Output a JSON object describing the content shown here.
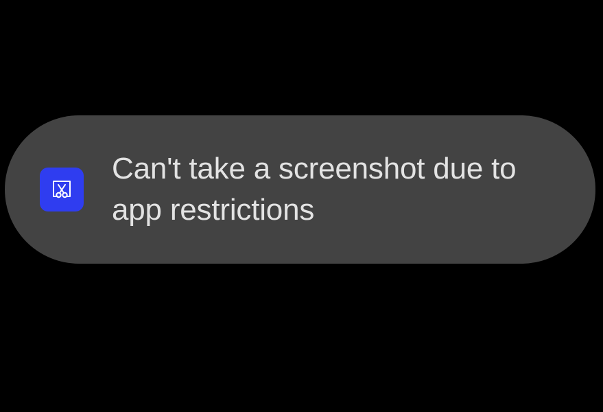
{
  "toast": {
    "message": "Can't take a screenshot due to app restrictions",
    "icon": "screenshot-blocked-icon",
    "icon_background": "#2f3df0",
    "background": "#434343"
  },
  "screen": {
    "background": "#000000"
  }
}
